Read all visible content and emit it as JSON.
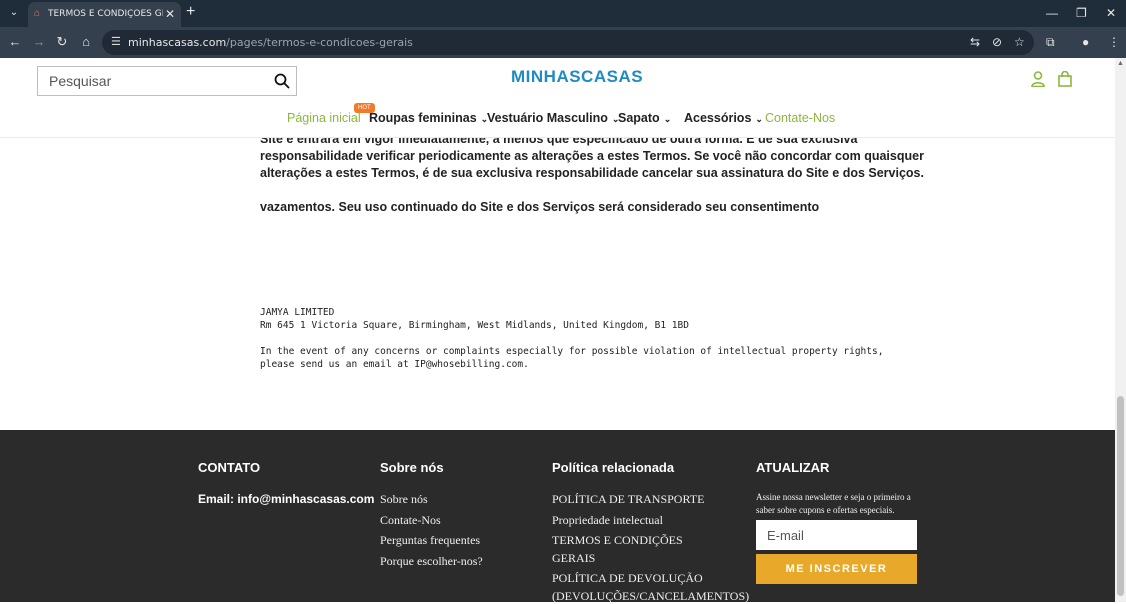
{
  "browser": {
    "tab_title": "TERMOS E CONDIÇÕES GERAIS",
    "url_domain": "minhascasas.com",
    "url_path": "/pages/termos-e-condicoes-gerais"
  },
  "header": {
    "search_placeholder": "Pesquisar",
    "logo_text": "MINHASCASAS",
    "nav": {
      "home": "Página inicial",
      "hot_badge": "HOT",
      "women": "Roupas femininas",
      "men": "Vestuário Masculino",
      "shoes": "Sapato",
      "accessories": "Acessórios",
      "contact": "Contate-Nos"
    },
    "colors": {
      "accent_green": "#8bb73a",
      "logo_blue": "#1f8bc2",
      "hot_orange": "#f07b29"
    }
  },
  "content": {
    "line1": "Site e entrará em vigor imediatamente, a menos que especificado de outra forma. É de sua exclusiva",
    "line2": "responsabilidade verificar periodicamente as alterações a estes Termos. Se você não concordar com quaisquer",
    "line3": "alterações a estes Termos, é de sua exclusiva responsabilidade cancelar sua assinatura do Site e dos Serviços.",
    "line4": "vazamentos. Seu uso continuado do Site e dos Serviços será considerado seu consentimento",
    "company": "JAMYA LIMITED",
    "address": "Rm 645 1 Victoria Square, Birmingham, West Midlands, United Kingdom, B1 1BD",
    "notice1": "In the event of any concerns or complaints especially for possible violation of intellectual property rights,",
    "notice2": "please send us an email at IP@whosebilling.com."
  },
  "footer": {
    "contato": {
      "title": "CONTATO",
      "email": "Email: info@minhascasas.com"
    },
    "sobre": {
      "title": "Sobre nós",
      "links": [
        "Sobre nós",
        "Contate-Nos",
        "Perguntas frequentes",
        "Porque escolher-nos?"
      ]
    },
    "politica": {
      "title": "Política relacionada",
      "links": [
        "POLÍTICA DE TRANSPORTE",
        "Propriedade intelectual",
        "TERMOS E CONDIÇÕES",
        "GERAIS",
        "POLÍTICA DE DEVOLUÇÃO",
        "(DEVOLUÇÕES/CANCELAMENTOS)"
      ]
    },
    "newsletter": {
      "title": "ATUALIZAR",
      "text": "Assine nossa newsletter e seja o primeiro a saber sobre cupons e ofertas especiais.",
      "email_placeholder": "E-mail",
      "button": "ME INSCREVER"
    },
    "colors": {
      "background": "#2b2b2b",
      "button": "#e8a92a"
    }
  }
}
